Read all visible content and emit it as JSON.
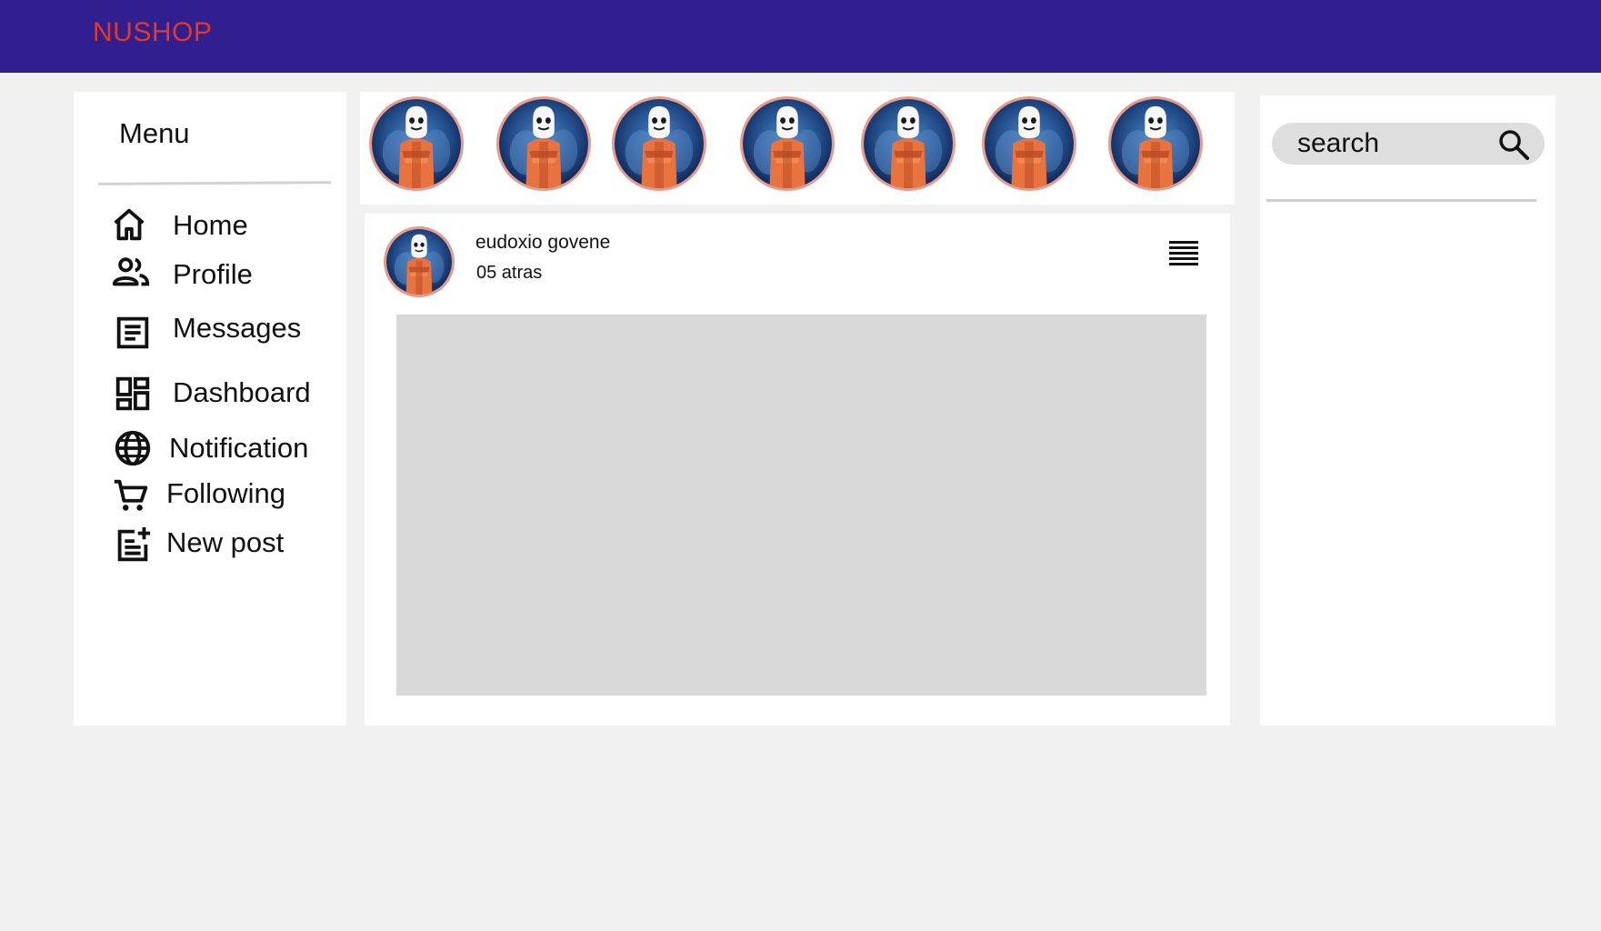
{
  "app": {
    "brand": "NUSHOP"
  },
  "sidebar": {
    "title": "Menu",
    "items": [
      {
        "label": "Home",
        "icon": "home-icon"
      },
      {
        "label": "Profile",
        "icon": "people-icon"
      },
      {
        "label": "Messages",
        "icon": "article-icon"
      },
      {
        "label": "Dashboard",
        "icon": "dashboard-icon"
      },
      {
        "label": "Notification",
        "icon": "globe-icon"
      },
      {
        "label": "Following",
        "icon": "cart-icon"
      },
      {
        "label": "New post",
        "icon": "post-add-icon"
      }
    ]
  },
  "stories": {
    "count": 7
  },
  "post": {
    "author": "eudoxio govene",
    "time": "05 atras",
    "menu_icon": "menu-lines-icon"
  },
  "search": {
    "placeholder": "search",
    "icon": "search-icon"
  },
  "colors": {
    "topbar": "#311e8f",
    "brand": "#e0392b",
    "background": "#f1f1f1",
    "panel": "#ffffff",
    "image_placeholder": "#d9d9d9",
    "story_ring": "#e59b8e"
  }
}
